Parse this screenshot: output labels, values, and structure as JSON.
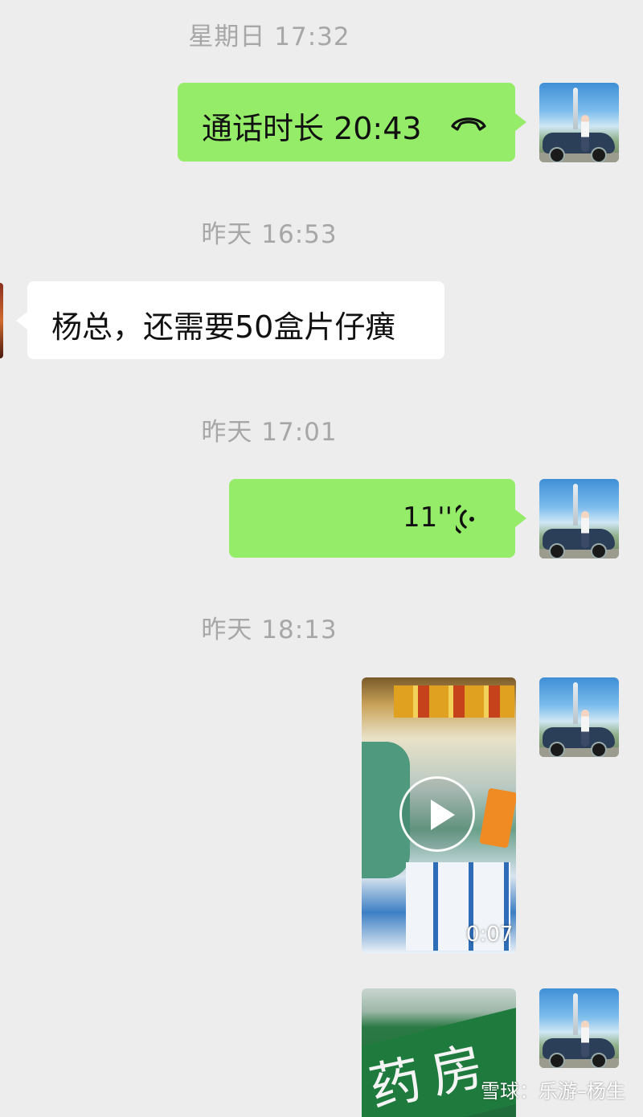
{
  "timestamps": [
    "星期日 17:32",
    "昨天 16:53",
    "昨天 17:01",
    "昨天 18:13"
  ],
  "call": {
    "label": "通话时长 20:43",
    "icon": "phone-hangup-icon"
  },
  "message_received": {
    "text": "杨总，还需要50盒片仔癀"
  },
  "voice": {
    "duration": "11''",
    "icon": "voice-wave-icon"
  },
  "video": {
    "duration": "0:07",
    "icon": "play-icon"
  },
  "photo": {
    "sign_text": "药房"
  },
  "watermark": {
    "text": "雪球：乐游–杨生"
  },
  "colors": {
    "sent_bubble": "#95ec69",
    "received_bubble": "#ffffff",
    "background": "#ededed",
    "timestamp": "#a7a7a7"
  }
}
